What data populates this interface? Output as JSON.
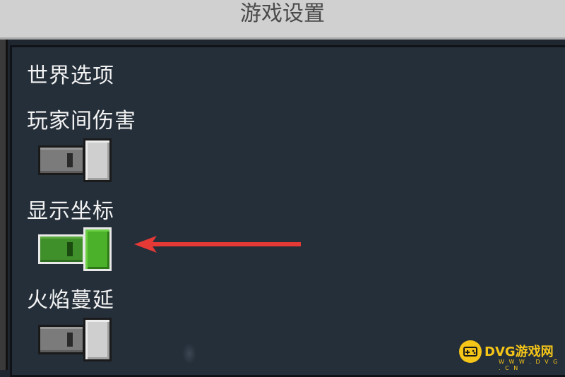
{
  "title": "游戏设置",
  "section": "世界选项",
  "options": [
    {
      "label": "玩家间伤害",
      "enabled": false
    },
    {
      "label": "显示坐标",
      "enabled": true
    },
    {
      "label": "火焰蔓延",
      "enabled": false
    }
  ],
  "colors": {
    "toggle_on": "#4bb12a",
    "toggle_off": "#cfcfcf",
    "arrow": "#e53935",
    "watermark": "#f5c518"
  },
  "icons": {
    "arrow": "red-arrow-icon",
    "logo": "gamepad-logo-icon"
  },
  "watermark": {
    "brand": "DVG游戏网",
    "url": "W W W . D V G . C N"
  }
}
